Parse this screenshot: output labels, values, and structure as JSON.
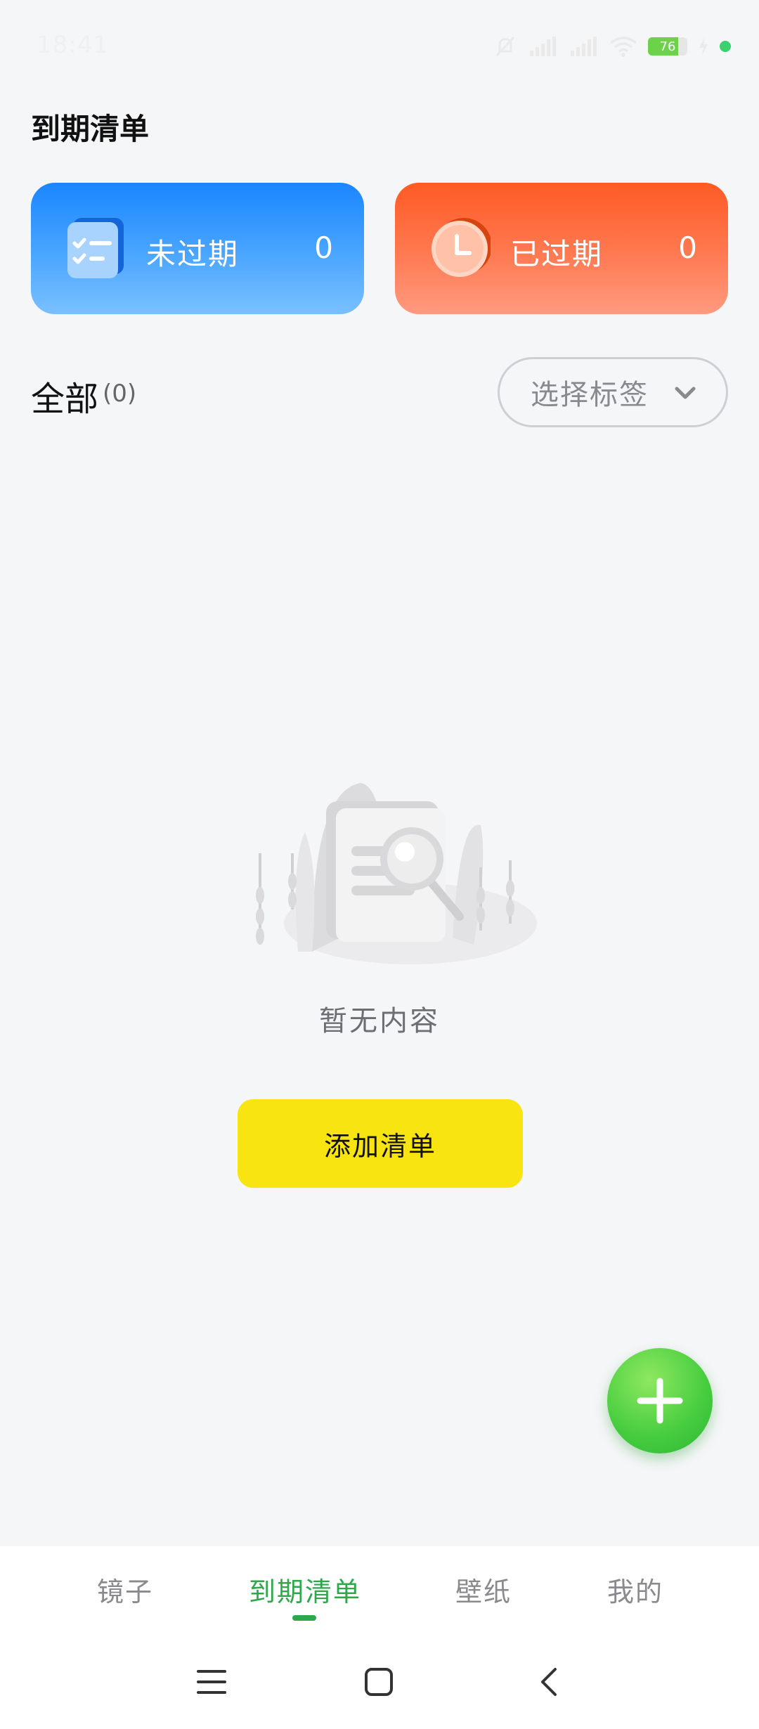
{
  "status_bar": {
    "time": "18:41",
    "battery_level": "76",
    "icons": [
      "mute-bell-icon",
      "signal-5g-icon",
      "signal-icon",
      "wifi-icon",
      "battery-icon",
      "charging-icon",
      "camera-indicator-dot"
    ]
  },
  "header": {
    "title": "到期清单"
  },
  "summary": {
    "not_expired": {
      "label": "未过期",
      "count": "0",
      "icon": "checklist-document-icon",
      "color": "#1a86ff"
    },
    "expired": {
      "label": "已过期",
      "count": "0",
      "icon": "clock-icon",
      "color": "#ff5a24"
    }
  },
  "filter": {
    "title": "全部",
    "count": "(0)",
    "tag_select_label": "选择标签"
  },
  "empty_state": {
    "message": "暂无内容",
    "button_label": "添加清单"
  },
  "fab": {
    "icon": "plus-icon",
    "color": "#45cc3e"
  },
  "tabs": [
    {
      "label": "镜子",
      "active": false
    },
    {
      "label": "到期清单",
      "active": true
    },
    {
      "label": "壁纸",
      "active": false
    },
    {
      "label": "我的",
      "active": false
    }
  ],
  "accent_color": "#2ea84a",
  "nav_bar": {
    "icons": [
      "menu-icon",
      "home-icon",
      "back-icon"
    ]
  }
}
